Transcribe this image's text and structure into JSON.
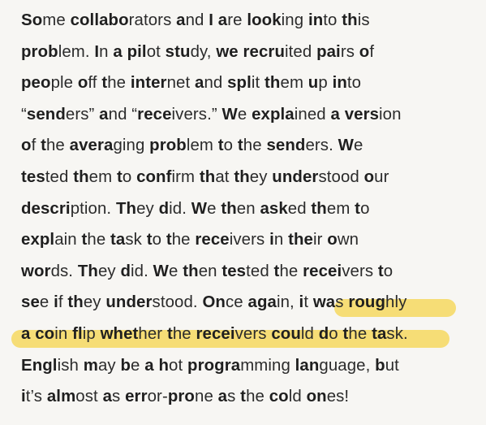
{
  "passage": {
    "lines": [
      [
        {
          "t": "So",
          "b": true
        },
        {
          "t": "me "
        },
        {
          "t": "collabo",
          "b": true
        },
        {
          "t": "rators "
        },
        {
          "t": "a",
          "b": true
        },
        {
          "t": "nd "
        },
        {
          "t": "I",
          "b": true
        },
        {
          "t": " "
        },
        {
          "t": "a",
          "b": true
        },
        {
          "t": "re "
        },
        {
          "t": "look",
          "b": true
        },
        {
          "t": "ing "
        },
        {
          "t": "in",
          "b": true
        },
        {
          "t": "to "
        },
        {
          "t": "th",
          "b": true
        },
        {
          "t": "is"
        }
      ],
      [
        {
          "t": "prob",
          "b": true
        },
        {
          "t": "lem. "
        },
        {
          "t": "I",
          "b": true
        },
        {
          "t": "n "
        },
        {
          "t": "a",
          "b": true
        },
        {
          "t": " "
        },
        {
          "t": "pil",
          "b": true
        },
        {
          "t": "ot "
        },
        {
          "t": "stu",
          "b": true
        },
        {
          "t": "dy, "
        },
        {
          "t": "we",
          "b": true
        },
        {
          "t": " "
        },
        {
          "t": "recru",
          "b": true
        },
        {
          "t": "ited "
        },
        {
          "t": "pai",
          "b": true
        },
        {
          "t": "rs "
        },
        {
          "t": "o",
          "b": true
        },
        {
          "t": "f"
        }
      ],
      [
        {
          "t": "peo",
          "b": true
        },
        {
          "t": "ple "
        },
        {
          "t": "o",
          "b": true
        },
        {
          "t": "ff "
        },
        {
          "t": "t",
          "b": true
        },
        {
          "t": "he "
        },
        {
          "t": "inter",
          "b": true
        },
        {
          "t": "net "
        },
        {
          "t": "a",
          "b": true
        },
        {
          "t": "nd "
        },
        {
          "t": "spl",
          "b": true
        },
        {
          "t": "it "
        },
        {
          "t": "th",
          "b": true
        },
        {
          "t": "em "
        },
        {
          "t": "u",
          "b": true
        },
        {
          "t": "p "
        },
        {
          "t": "in",
          "b": true
        },
        {
          "t": "to"
        }
      ],
      [
        {
          "t": "“"
        },
        {
          "t": "send",
          "b": true
        },
        {
          "t": "ers” "
        },
        {
          "t": "a",
          "b": true
        },
        {
          "t": "nd “"
        },
        {
          "t": "rece",
          "b": true
        },
        {
          "t": "ivers.” "
        },
        {
          "t": "W",
          "b": true
        },
        {
          "t": "e "
        },
        {
          "t": "expla",
          "b": true
        },
        {
          "t": "ined "
        },
        {
          "t": "a",
          "b": true
        },
        {
          "t": " "
        },
        {
          "t": "vers",
          "b": true
        },
        {
          "t": "ion"
        }
      ],
      [
        {
          "t": "o",
          "b": true
        },
        {
          "t": "f "
        },
        {
          "t": "t",
          "b": true
        },
        {
          "t": "he "
        },
        {
          "t": "avera",
          "b": true
        },
        {
          "t": "ging "
        },
        {
          "t": "prob",
          "b": true
        },
        {
          "t": "lem "
        },
        {
          "t": "t",
          "b": true
        },
        {
          "t": "o "
        },
        {
          "t": "t",
          "b": true
        },
        {
          "t": "he "
        },
        {
          "t": "send",
          "b": true
        },
        {
          "t": "ers. "
        },
        {
          "t": "W",
          "b": true
        },
        {
          "t": "e"
        }
      ],
      [
        {
          "t": "tes",
          "b": true
        },
        {
          "t": "ted "
        },
        {
          "t": "th",
          "b": true
        },
        {
          "t": "em "
        },
        {
          "t": "t",
          "b": true
        },
        {
          "t": "o "
        },
        {
          "t": "conf",
          "b": true
        },
        {
          "t": "irm "
        },
        {
          "t": "th",
          "b": true
        },
        {
          "t": "at "
        },
        {
          "t": "th",
          "b": true
        },
        {
          "t": "ey "
        },
        {
          "t": "under",
          "b": true
        },
        {
          "t": "stood "
        },
        {
          "t": "o",
          "b": true
        },
        {
          "t": "ur"
        }
      ],
      [
        {
          "t": "descri",
          "b": true
        },
        {
          "t": "ption. "
        },
        {
          "t": "Th",
          "b": true
        },
        {
          "t": "ey "
        },
        {
          "t": "d",
          "b": true
        },
        {
          "t": "id. "
        },
        {
          "t": "W",
          "b": true
        },
        {
          "t": "e "
        },
        {
          "t": "th",
          "b": true
        },
        {
          "t": "en "
        },
        {
          "t": "ask",
          "b": true
        },
        {
          "t": "ed "
        },
        {
          "t": "th",
          "b": true
        },
        {
          "t": "em "
        },
        {
          "t": "t",
          "b": true
        },
        {
          "t": "o"
        }
      ],
      [
        {
          "t": "expl",
          "b": true
        },
        {
          "t": "ain "
        },
        {
          "t": "t",
          "b": true
        },
        {
          "t": "he "
        },
        {
          "t": "ta",
          "b": true
        },
        {
          "t": "sk "
        },
        {
          "t": "t",
          "b": true
        },
        {
          "t": "o "
        },
        {
          "t": "t",
          "b": true
        },
        {
          "t": "he "
        },
        {
          "t": "rece",
          "b": true
        },
        {
          "t": "ivers "
        },
        {
          "t": "i",
          "b": true
        },
        {
          "t": "n "
        },
        {
          "t": "the",
          "b": true
        },
        {
          "t": "ir "
        },
        {
          "t": "o",
          "b": true
        },
        {
          "t": "wn"
        }
      ],
      [
        {
          "t": "wor",
          "b": true
        },
        {
          "t": "ds. "
        },
        {
          "t": "Th",
          "b": true
        },
        {
          "t": "ey "
        },
        {
          "t": "d",
          "b": true
        },
        {
          "t": "id. "
        },
        {
          "t": "W",
          "b": true
        },
        {
          "t": "e "
        },
        {
          "t": "th",
          "b": true
        },
        {
          "t": "en "
        },
        {
          "t": "tes",
          "b": true
        },
        {
          "t": "ted "
        },
        {
          "t": "t",
          "b": true
        },
        {
          "t": "he "
        },
        {
          "t": "recei",
          "b": true
        },
        {
          "t": "vers "
        },
        {
          "t": "t",
          "b": true
        },
        {
          "t": "o"
        }
      ],
      [
        {
          "t": "se",
          "b": true
        },
        {
          "t": "e "
        },
        {
          "t": "i",
          "b": true
        },
        {
          "t": "f "
        },
        {
          "t": "th",
          "b": true
        },
        {
          "t": "ey "
        },
        {
          "t": "under",
          "b": true
        },
        {
          "t": "stood. "
        },
        {
          "t": "On",
          "b": true
        },
        {
          "t": "ce "
        },
        {
          "t": "aga",
          "b": true
        },
        {
          "t": "in, "
        },
        {
          "t": "i",
          "b": true
        },
        {
          "t": "t "
        },
        {
          "t": "wa",
          "b": true
        },
        {
          "t": "s "
        },
        {
          "t": "roug",
          "b": true
        },
        {
          "t": "hly"
        }
      ],
      [
        {
          "t": "a",
          "b": true
        },
        {
          "t": " "
        },
        {
          "t": "co",
          "b": true
        },
        {
          "t": "in "
        },
        {
          "t": "fl",
          "b": true
        },
        {
          "t": "ip "
        },
        {
          "t": "whet",
          "b": true
        },
        {
          "t": "her "
        },
        {
          "t": "t",
          "b": true
        },
        {
          "t": "he "
        },
        {
          "t": "recei",
          "b": true
        },
        {
          "t": "vers "
        },
        {
          "t": "cou",
          "b": true
        },
        {
          "t": "ld "
        },
        {
          "t": "d",
          "b": true
        },
        {
          "t": "o "
        },
        {
          "t": "t",
          "b": true
        },
        {
          "t": "he "
        },
        {
          "t": "ta",
          "b": true
        },
        {
          "t": "sk."
        }
      ],
      [
        {
          "t": "Engl",
          "b": true
        },
        {
          "t": "ish "
        },
        {
          "t": "m",
          "b": true
        },
        {
          "t": "ay "
        },
        {
          "t": "b",
          "b": true
        },
        {
          "t": "e "
        },
        {
          "t": "a",
          "b": true
        },
        {
          "t": " "
        },
        {
          "t": "h",
          "b": true
        },
        {
          "t": "ot "
        },
        {
          "t": "progra",
          "b": true
        },
        {
          "t": "mming "
        },
        {
          "t": "lan",
          "b": true
        },
        {
          "t": "guage, "
        },
        {
          "t": "b",
          "b": true
        },
        {
          "t": "ut"
        }
      ],
      [
        {
          "t": "i",
          "b": true
        },
        {
          "t": "t’s "
        },
        {
          "t": "alm",
          "b": true
        },
        {
          "t": "ost "
        },
        {
          "t": "a",
          "b": true
        },
        {
          "t": "s "
        },
        {
          "t": "err",
          "b": true
        },
        {
          "t": "or-"
        },
        {
          "t": "pro",
          "b": true
        },
        {
          "t": "ne "
        },
        {
          "t": "a",
          "b": true
        },
        {
          "t": "s "
        },
        {
          "t": "t",
          "b": true
        },
        {
          "t": "he "
        },
        {
          "t": "co",
          "b": true
        },
        {
          "t": "ld "
        },
        {
          "t": "on",
          "b": true
        },
        {
          "t": "es!"
        }
      ]
    ]
  },
  "highlight": {
    "color": "#f6d85f"
  }
}
